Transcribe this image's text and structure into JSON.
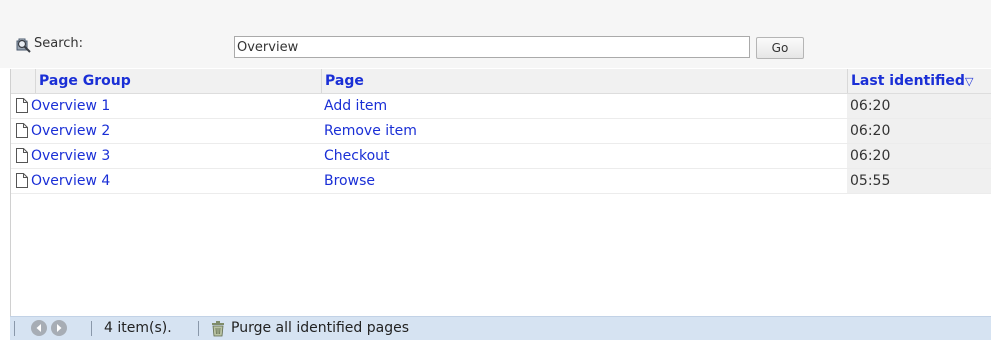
{
  "search": {
    "label": "Search:",
    "value": "Overview",
    "go_label": "Go"
  },
  "table": {
    "columns": {
      "page_group": "Page Group",
      "page": "Page",
      "last_identified": "Last identified"
    },
    "sort_indicator": "▽",
    "rows": [
      {
        "page_group": "Overview 1",
        "page": "Add item",
        "last_identified": "06:20"
      },
      {
        "page_group": "Overview 2",
        "page": "Remove item",
        "last_identified": "06:20"
      },
      {
        "page_group": "Overview 3",
        "page": "Checkout",
        "last_identified": "06:20"
      },
      {
        "page_group": "Overview 4",
        "page": "Browse",
        "last_identified": "05:55"
      }
    ]
  },
  "footer": {
    "item_count": "4 item(s).",
    "purge_label": "Purge all identified pages"
  },
  "colors": {
    "link": "#1a2fd6",
    "footer_bg": "#d6e3f2",
    "nav_button": "#a7adb5"
  },
  "icons": {
    "search": "search-icon",
    "row": "document-icon",
    "prev": "previous-page-icon",
    "next": "next-page-icon",
    "purge": "trash-icon"
  }
}
